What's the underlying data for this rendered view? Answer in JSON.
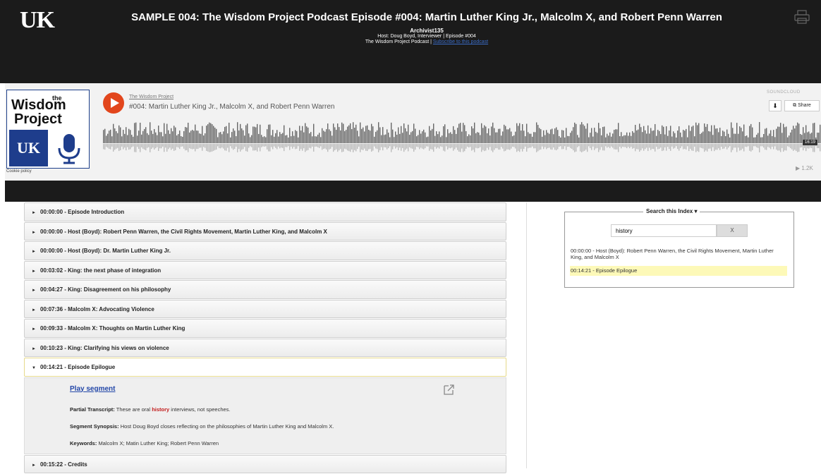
{
  "header": {
    "logo": "UK",
    "title": "SAMPLE 004: The Wisdom Project Podcast Episode #004: Martin Luther King Jr., Malcolm X, and Robert Penn Warren",
    "archivist": "Archivist135",
    "host_line": "Host: Doug Boyd, Interviewer | Episode #004",
    "podcast_label": "The Wisdom Project Podcast |",
    "subscribe_link": "Subscribe to this podcast"
  },
  "player": {
    "logo_the": "the",
    "logo_line1": "Wisdom",
    "logo_line2": "Project",
    "logo_uk": "UK",
    "cookie": "Cookie policy",
    "track_user": "The Wisdom Project",
    "track_title": "#004: Martin Luther King Jr., Malcolm X, and Robert Penn Warren",
    "brand": "SOUNDCLOUD",
    "download_icon": "download-icon",
    "share_label": "Share",
    "duration": "16:19",
    "plays": "▶ 1.2K"
  },
  "index": {
    "segments": [
      {
        "label": "00:00:00 - Episode Introduction"
      },
      {
        "label": "00:00:00 - Host (Boyd): Robert Penn Warren, the Civil Rights Movement, Martin Luther King, and Malcolm X"
      },
      {
        "label": "00:00:00 - Host (Boyd): Dr. Martin Luther King Jr."
      },
      {
        "label": "00:03:02 - King: the next phase of integration"
      },
      {
        "label": "00:04:27 - King: Disagreement on his philosophy"
      },
      {
        "label": "00:07:36 - Malcolm X: Advocating Violence"
      },
      {
        "label": "00:09:33 - Malcolm X: Thoughts on Martin Luther King"
      },
      {
        "label": "00:10:23 - King: Clarifying his views on violence"
      },
      {
        "label": "00:14:21 - Episode Epilogue"
      },
      {
        "label": "00:15:22 - Credits"
      }
    ],
    "detail": {
      "play_segment": "Play segment",
      "transcript_label": "Partial Transcript:",
      "transcript_pre": "These are oral",
      "transcript_hl": "history",
      "transcript_post": "interviews, not speeches.",
      "synopsis_label": "Segment Synopsis:",
      "synopsis": "Host Doug Boyd closes reflecting on the philosophies of Martin Luther King and Malcolm X.",
      "keywords_label": "Keywords:",
      "keywords": "Malcolm X; Matin Luther King; Robert Penn Warren"
    }
  },
  "search": {
    "legend": "Search this Index ▾",
    "query": "history",
    "clear": "X",
    "results": [
      "00:00:00 - Host (Boyd): Robert Penn Warren, the Civil Rights Movement, Martin Luther King, and Malcolm X",
      "00:14:21 - Episode Epilogue"
    ]
  },
  "colors": {
    "header_bg": "#1b1b1b",
    "play_orange": "#e2461c",
    "uk_blue": "#1e3d8c",
    "link_blue": "#2347a8",
    "highlight_yellow": "#fdf9b8",
    "hit_red": "#c21a1a"
  }
}
